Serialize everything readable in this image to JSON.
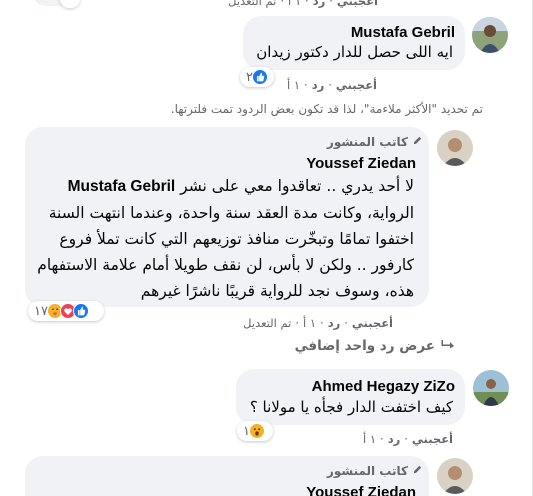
{
  "top_partial": {
    "meta": {
      "like": "أعجبني",
      "reply": "رد",
      "time": "١ أ",
      "edited": "تم التعديل"
    }
  },
  "comments": [
    {
      "author": "Mustafa Gebril",
      "lines": [
        "ايه اللى حصل للدار دكتور زيدان"
      ],
      "meta": {
        "like": "أعجبني",
        "reply": "رد",
        "time": "١ أ"
      },
      "reaction_count": "٢"
    },
    {
      "author_badge": "كاتب المنشور",
      "author": "Youssef Ziedan",
      "mention": "Mustafa Gebril",
      "lines": [
        "لا أحد يدري .. تعاقدوا معي على نشر",
        "الرواية، وكانت مدة العقد سنة واحدة، وعندما انتهت السنة",
        "اختفوا تمامًا وتبخّرت منافذ توزيعهم التي كانت تملأ فروع",
        "كارفور .. ولكن لا بأس، لن نقف طويلا أمام علامة الاستفهام",
        "هذه، وسوف نجد للرواية قريبًا ناشرًا غيرهم"
      ],
      "meta": {
        "like": "أعجبني",
        "reply": "رد",
        "time": "١ أ",
        "edited": "تم التعديل"
      },
      "reaction_count": "١٧"
    },
    {
      "author": "Ahmed Hegazy ZiZo",
      "lines": [
        "كيف اختفت الدار فجأه يا مولانا ؟"
      ],
      "meta": {
        "like": "أعجبني",
        "reply": "رد",
        "time": "١ أ"
      },
      "reaction_count": "١"
    },
    {
      "author_badge": "كاتب المنشور",
      "author": "Youssef Ziedan"
    }
  ],
  "filter_notice": "تم تحديد \"الأكثر ملاءمة\"، لذا قد تكون بعض الردود تمت فلترتها.",
  "more_replies": "عرض رد واحد إضافي",
  "colors": {
    "bubble": "#f0f2f5",
    "meta_text": "#65676b",
    "like_blue": "#1877f2",
    "love_red": "#f33e58",
    "haha_yellow": "#f7b125"
  }
}
